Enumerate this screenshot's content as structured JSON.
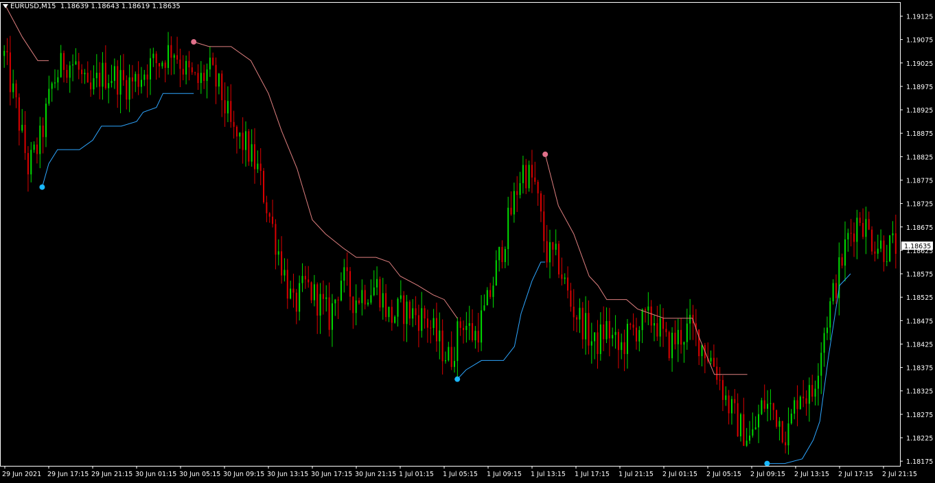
{
  "header": {
    "symbol": "EURUSD,M15",
    "ohlc": "1.18639 1.18643 1.18619 1.18635"
  },
  "colors": {
    "background": "#000000",
    "grid_frame": "#ffffff",
    "bull_candle": "#00dd00",
    "bear_candle": "#dd0000",
    "resistance_line": "#e08080",
    "support_line": "#2ea6ff",
    "resistance_dot": "#e0708a",
    "support_dot": "#1ab8ff",
    "price_tag_bg": "#ffffff",
    "price_tag_text": "#000000"
  },
  "chart_data": {
    "type": "candlestick",
    "title": "",
    "ylim": [
      1.18165,
      1.19155
    ],
    "current_price_label": "1.18635",
    "y_ticks": [
      "1.19125",
      "1.19075",
      "1.19025",
      "1.18975",
      "1.18925",
      "1.18875",
      "1.18825",
      "1.18775",
      "1.18725",
      "1.18675",
      "1.18625",
      "1.18575",
      "1.18525",
      "1.18475",
      "1.18425",
      "1.18375",
      "1.18325",
      "1.18275",
      "1.18225",
      "1.18175"
    ],
    "x_ticks": [
      "29 Jun 2021",
      "29 Jun 17:15",
      "29 Jun 21:15",
      "30 Jun 01:15",
      "30 Jun 05:15",
      "30 Jun 09:15",
      "30 Jun 13:15",
      "30 Jun 17:15",
      "30 Jun 21:15",
      "1 Jul 01:15",
      "1 Jul 05:15",
      "1 Jul 09:15",
      "1 Jul 13:15",
      "1 Jul 17:15",
      "1 Jul 21:15",
      "2 Jul 01:15",
      "2 Jul 05:15",
      "2 Jul 09:15",
      "2 Jul 13:15",
      "2 Jul 17:15",
      "2 Jul 21:15"
    ],
    "close_path": [
      1.1904,
      1.1893,
      1.188,
      1.1886,
      1.1898,
      1.1903,
      1.1902,
      1.1895,
      1.19,
      1.19,
      1.1898,
      1.1899,
      1.1902,
      1.1903,
      1.1906,
      1.1901,
      1.1898,
      1.1901,
      1.1896,
      1.1887,
      1.1885,
      1.188,
      1.187,
      1.186,
      1.185,
      1.1855,
      1.1852,
      1.1848,
      1.1857,
      1.1852,
      1.1854,
      1.1855,
      1.1848,
      1.185,
      1.1849,
      1.1848,
      1.1843,
      1.1839,
      1.1848,
      1.1844,
      1.185,
      1.186,
      1.187,
      1.188,
      1.1877,
      1.1862,
      1.186,
      1.1851,
      1.1847,
      1.1842,
      1.1846,
      1.1841,
      1.1845,
      1.1847,
      1.1848,
      1.1842,
      1.1844,
      1.1846,
      1.1842,
      1.1838,
      1.183,
      1.1825,
      1.1822,
      1.183,
      1.1828,
      1.1823,
      1.1833,
      1.1831,
      1.1845,
      1.1855,
      1.1865,
      1.187,
      1.1865,
      1.1863,
      1.18635
    ],
    "resistance": [
      {
        "x": 0.0,
        "y": 1.1915
      },
      {
        "x": 0.8,
        "y": 1.1908
      },
      {
        "x": 1.5,
        "y": 1.1903
      },
      {
        "x": 2.0,
        "y": 1.1903
      }
    ],
    "resistance_2": [
      {
        "x": 8.6,
        "y": 1.1907
      },
      {
        "x": 9.3,
        "y": 1.1906
      },
      {
        "x": 10.3,
        "y": 1.1906
      },
      {
        "x": 11.2,
        "y": 1.1903
      },
      {
        "x": 12.0,
        "y": 1.1896
      },
      {
        "x": 12.6,
        "y": 1.1888
      },
      {
        "x": 13.3,
        "y": 1.188
      },
      {
        "x": 14.0,
        "y": 1.1869
      },
      {
        "x": 14.6,
        "y": 1.1866
      },
      {
        "x": 15.4,
        "y": 1.1863
      },
      {
        "x": 16.0,
        "y": 1.1861
      },
      {
        "x": 16.9,
        "y": 1.1861
      },
      {
        "x": 17.5,
        "y": 1.186
      },
      {
        "x": 18.0,
        "y": 1.1857
      },
      {
        "x": 18.8,
        "y": 1.1855
      },
      {
        "x": 19.5,
        "y": 1.1853
      },
      {
        "x": 20.0,
        "y": 1.1852
      },
      {
        "x": 20.6,
        "y": 1.1848
      }
    ],
    "resistance_3": [
      {
        "x": 24.6,
        "y": 1.1883
      },
      {
        "x": 25.2,
        "y": 1.1872
      },
      {
        "x": 25.9,
        "y": 1.1866
      },
      {
        "x": 26.6,
        "y": 1.1857
      },
      {
        "x": 27.0,
        "y": 1.1855
      },
      {
        "x": 27.4,
        "y": 1.1852
      },
      {
        "x": 28.3,
        "y": 1.1852
      },
      {
        "x": 28.8,
        "y": 1.185
      },
      {
        "x": 29.4,
        "y": 1.1849
      },
      {
        "x": 30.0,
        "y": 1.1848
      },
      {
        "x": 31.3,
        "y": 1.1848
      },
      {
        "x": 31.6,
        "y": 1.1844
      },
      {
        "x": 32.3,
        "y": 1.1836
      },
      {
        "x": 33.8,
        "y": 1.1836
      }
    ],
    "support": [
      {
        "x": 1.7,
        "y": 1.1876
      },
      {
        "x": 2.0,
        "y": 1.1881
      },
      {
        "x": 2.4,
        "y": 1.1884
      },
      {
        "x": 3.4,
        "y": 1.1884
      },
      {
        "x": 4.0,
        "y": 1.1886
      },
      {
        "x": 4.4,
        "y": 1.1889
      },
      {
        "x": 5.3,
        "y": 1.1889
      },
      {
        "x": 6.0,
        "y": 1.189
      },
      {
        "x": 6.3,
        "y": 1.1892
      },
      {
        "x": 6.9,
        "y": 1.1893
      },
      {
        "x": 7.2,
        "y": 1.1896
      },
      {
        "x": 8.6,
        "y": 1.1896
      }
    ],
    "support_2": [
      {
        "x": 20.6,
        "y": 1.1835
      },
      {
        "x": 21.0,
        "y": 1.1837
      },
      {
        "x": 21.7,
        "y": 1.1839
      },
      {
        "x": 22.7,
        "y": 1.1839
      },
      {
        "x": 23.2,
        "y": 1.1842
      },
      {
        "x": 23.5,
        "y": 1.1849
      },
      {
        "x": 24.0,
        "y": 1.1856
      },
      {
        "x": 24.4,
        "y": 1.186
      },
      {
        "x": 24.6,
        "y": 1.186
      }
    ],
    "support_3": [
      {
        "x": 34.7,
        "y": 1.1817
      },
      {
        "x": 35.5,
        "y": 1.1817
      },
      {
        "x": 36.3,
        "y": 1.1818
      },
      {
        "x": 36.8,
        "y": 1.1822
      },
      {
        "x": 37.1,
        "y": 1.1826
      },
      {
        "x": 37.5,
        "y": 1.184
      },
      {
        "x": 38.0,
        "y": 1.1855
      },
      {
        "x": 38.5,
        "y": 1.18575
      }
    ],
    "resistance_dots": [
      {
        "x": 8.6,
        "y": 1.1907
      },
      {
        "x": 24.6,
        "y": 1.1883
      }
    ],
    "support_dots": [
      {
        "x": 1.7,
        "y": 1.1876
      },
      {
        "x": 20.6,
        "y": 1.1835
      },
      {
        "x": 34.7,
        "y": 1.1817
      }
    ]
  }
}
